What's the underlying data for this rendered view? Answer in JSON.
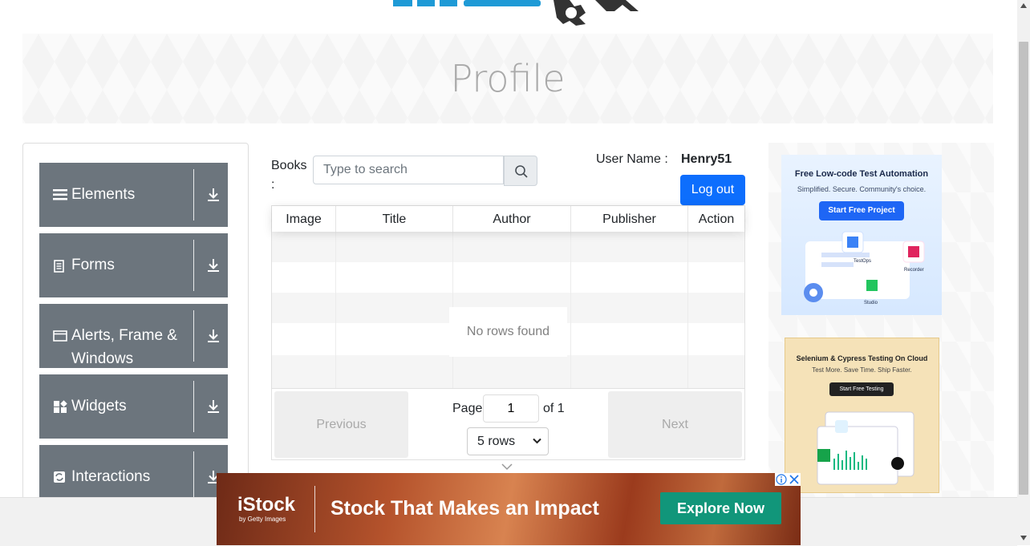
{
  "page": {
    "title": "Profile"
  },
  "sidebar": {
    "groups": [
      {
        "label": "Elements",
        "icon": "hamburger-icon"
      },
      {
        "label": "Forms",
        "icon": "form-icon"
      },
      {
        "label": "Alerts, Frame & Windows",
        "icon": "window-icon"
      },
      {
        "label": "Widgets",
        "icon": "widgets-icon"
      },
      {
        "label": "Interactions",
        "icon": "interactions-icon"
      }
    ]
  },
  "books": {
    "label": "Books :",
    "search_placeholder": "Type to search",
    "user_name_label": "User Name :",
    "user_name": "Henry51",
    "logout_label": "Log out",
    "columns": [
      "Image",
      "Title",
      "Author",
      "Publisher",
      "Action"
    ],
    "empty_message": "No rows found",
    "pagination": {
      "previous": "Previous",
      "next": "Next",
      "page_label": "Page",
      "page_value": "1",
      "of_label": "of 1",
      "rows_option": "5 rows"
    }
  },
  "ads": {
    "right_top": {
      "title": "Free Low-code Test Automation",
      "subtitle": "Simplified. Secure. Community's choice.",
      "button": "Start Free Project",
      "labels": [
        "TestOps",
        "Recorder",
        "Studio"
      ]
    },
    "right_bottom": {
      "title": "Selenium & Cypress Testing On Cloud",
      "subtitle": "Test More. Save Time. Ship Faster.",
      "button": "Start Free Testing"
    },
    "bottom": {
      "brand": "iStock",
      "brand_sub": "by Getty Images",
      "headline": "Stock That Makes an Impact",
      "cta": "Explore Now"
    }
  },
  "colors": {
    "accent": "#0d6efd",
    "sidebar_group": "#6c757d",
    "cta_green": "#11967a"
  }
}
